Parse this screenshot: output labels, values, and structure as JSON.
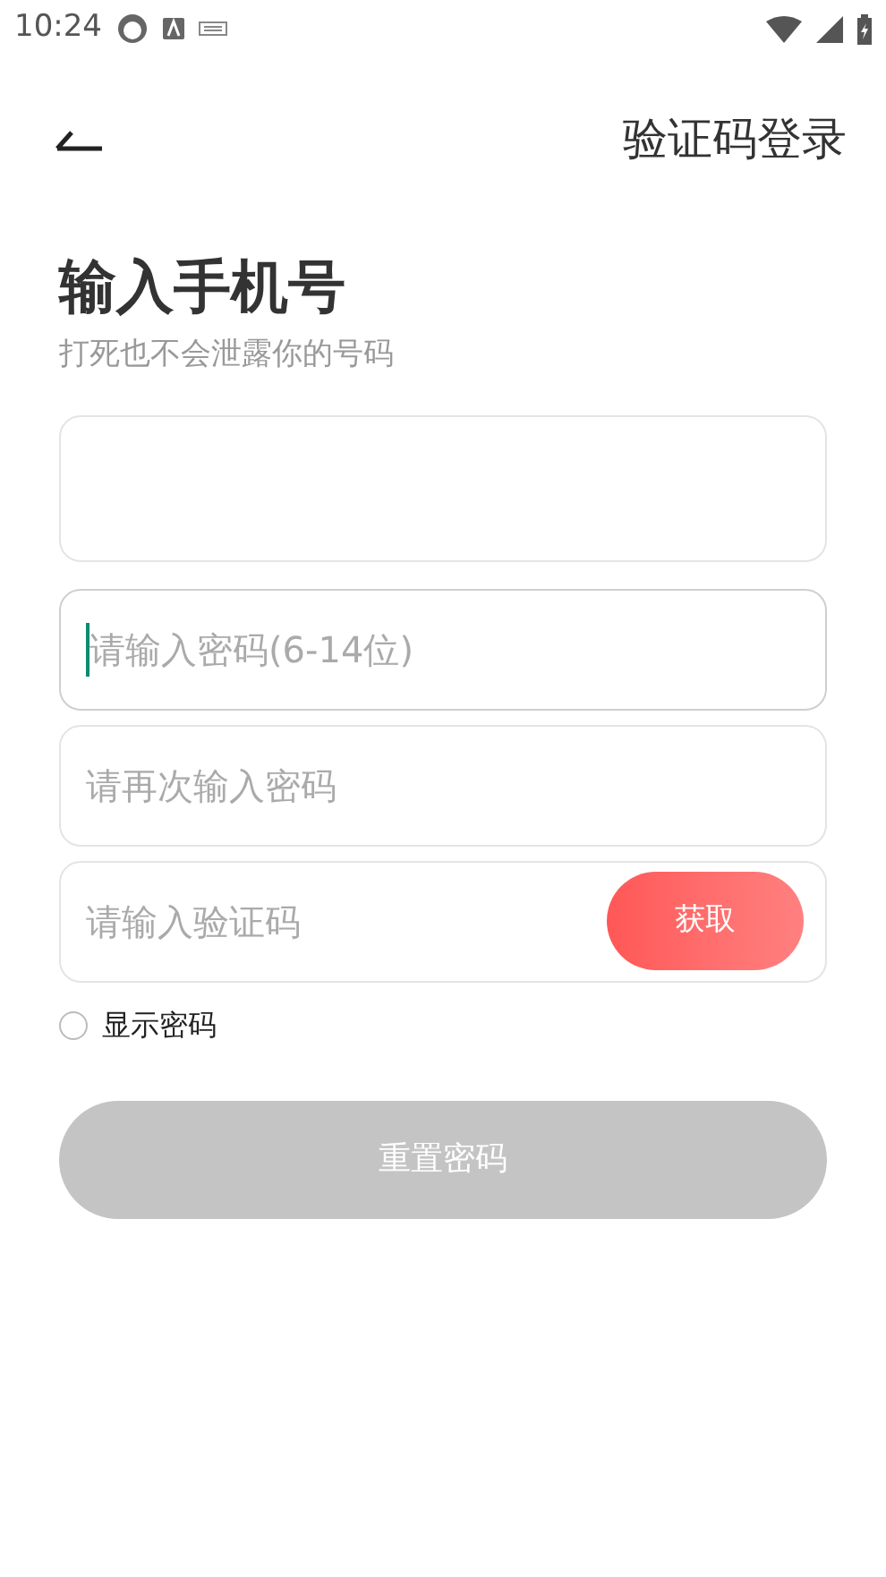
{
  "status_bar": {
    "time": "10:24"
  },
  "header": {
    "action": "验证码登录"
  },
  "title": "输入手机号",
  "subtitle": "打死也不会泄露你的号码",
  "fields": [
    {
      "kind": "tall",
      "focused": false
    },
    {
      "kind": "text",
      "placeholder": "请输入密码(6-14位)",
      "focused": true
    },
    {
      "kind": "text",
      "placeholder": "请再次输入密码",
      "focused": false
    },
    {
      "kind": "code",
      "placeholder": "请输入验证码",
      "focused": false,
      "button": "获取"
    }
  ],
  "show_password": {
    "label": "显示密码",
    "checked": false
  },
  "submit": {
    "label": "重置密码",
    "disabled": true
  }
}
